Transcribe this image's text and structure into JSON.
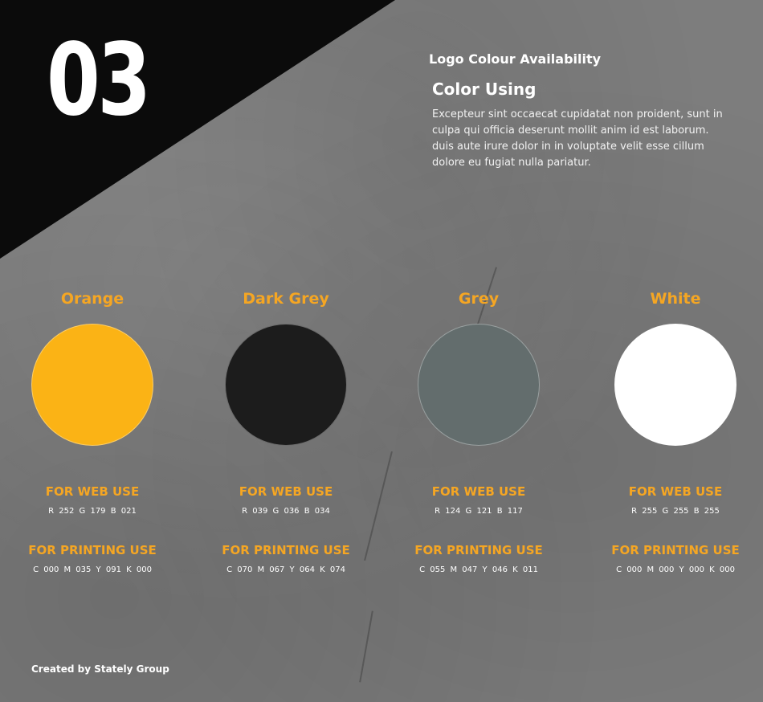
{
  "section_number": "03",
  "eyebrow": "Logo Colour Availability",
  "heading": "Color Using",
  "paragraph": "Excepteur sint occaecat cupidatat non proident, sunt in culpa qui officia deserunt mollit anim id est laborum. duis aute irure dolor in in voluptate velit esse cillum dolore eu fugiat nulla pariatur.",
  "colors": [
    {
      "name": "Orange",
      "hex": "#fbb315",
      "web_label": "FOR WEB USE",
      "web_value": "R 252  G 179  B 021",
      "print_label": "FOR PRINTING USE",
      "print_value": "C 000  M 035  Y 091  K 000"
    },
    {
      "name": "Dark Grey",
      "hex": "#1c1c1c",
      "web_label": "FOR WEB USE",
      "web_value": "R 039  G 036  B 034",
      "print_label": "FOR PRINTING USE",
      "print_value": "C 070  M 067  Y 064  K 074"
    },
    {
      "name": "Grey",
      "hex": "#636d6d",
      "web_label": "FOR WEB USE",
      "web_value": "R 124  G 121  B 117",
      "print_label": "FOR PRINTING USE",
      "print_value": "C 055  M 047  Y 046  K 011"
    },
    {
      "name": "White",
      "hex": "#ffffff",
      "web_label": "FOR WEB USE",
      "web_value": "R 255  G 255  B 255",
      "print_label": "FOR PRINTING USE",
      "print_value": "C 000  M 000  Y 000  K 000"
    }
  ],
  "credit": "Created by Stately Group",
  "accent_color": "#f5a623",
  "corner_color": "#0b0b0b"
}
